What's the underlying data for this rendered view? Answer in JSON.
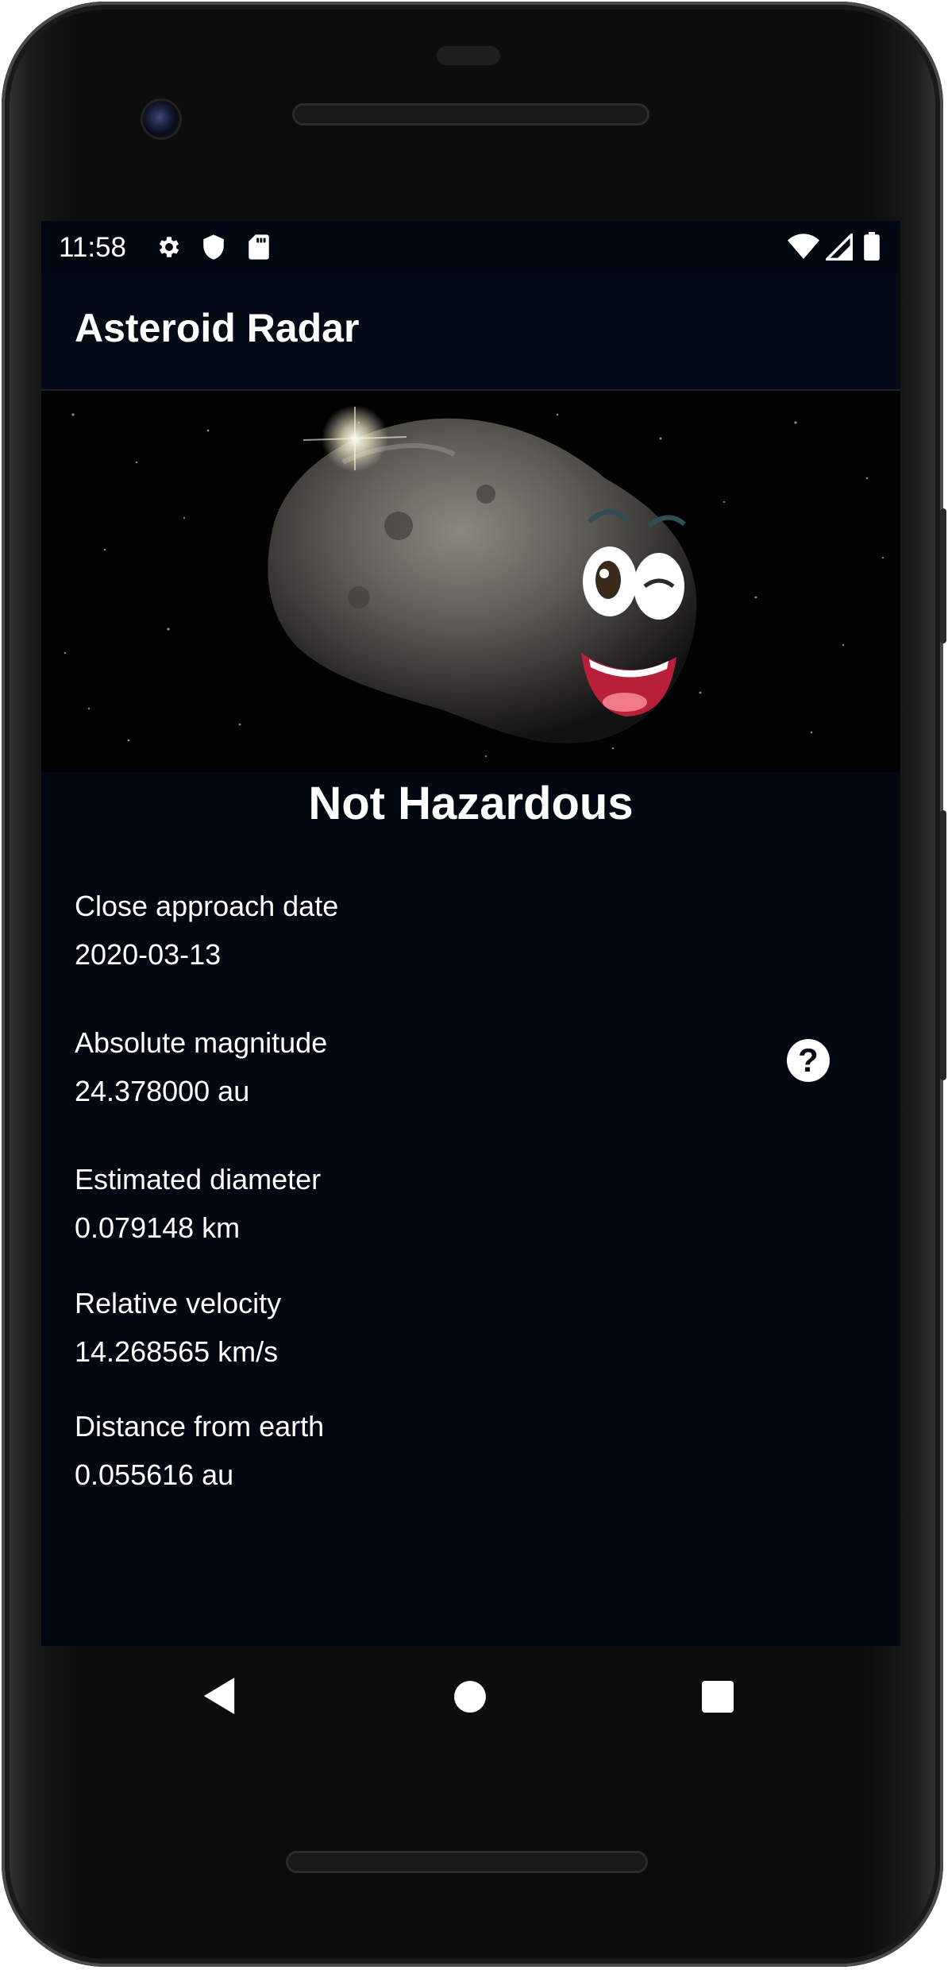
{
  "status_bar": {
    "time": "11:58",
    "left_icons": [
      "settings-icon",
      "shield-icon",
      "sd-card-icon"
    ],
    "right_icons": [
      "wifi-icon",
      "signal-icon",
      "battery-icon"
    ]
  },
  "app_bar": {
    "title": "Asteroid Radar"
  },
  "hero": {
    "image": "smiling-asteroid-illustration"
  },
  "hazard_status": "Not Hazardous",
  "details": [
    {
      "label": "Close approach date",
      "value": "2020-03-13"
    },
    {
      "label": "Absolute magnitude",
      "value": "24.378000 au"
    },
    {
      "label": "Estimated diameter",
      "value": "0.079148 km"
    },
    {
      "label": "Relative velocity",
      "value": "14.268565 km/s"
    },
    {
      "label": "Distance from earth",
      "value": "0.055616 au"
    }
  ],
  "help_button": {
    "icon": "help-icon",
    "glyph": "?"
  },
  "nav_bar": {
    "buttons": [
      "back-icon",
      "home-icon",
      "recents-icon"
    ]
  },
  "colors": {
    "screen_bg": "#030712",
    "app_bar_bg": "#050a17",
    "text": "#ffffff"
  }
}
